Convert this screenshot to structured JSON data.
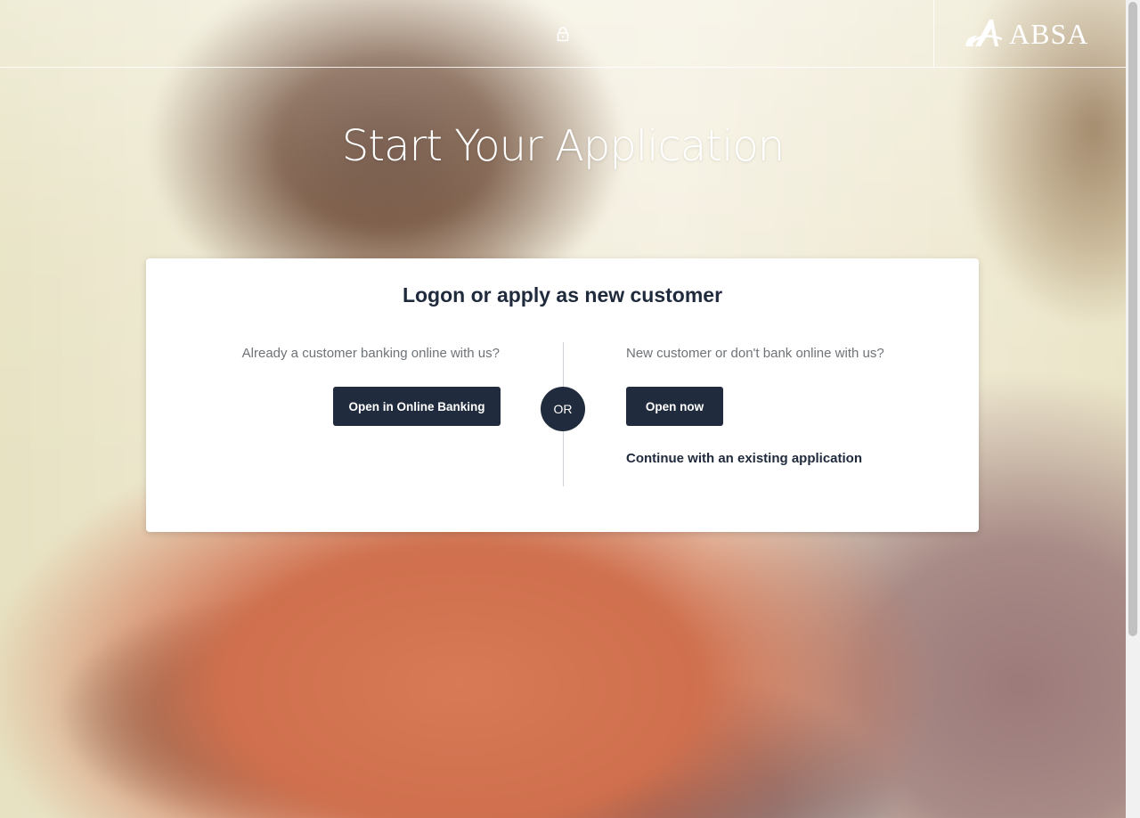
{
  "header": {
    "lock_icon": "lock-icon",
    "logo_text": "ABSA"
  },
  "page": {
    "title": "Start Your Application"
  },
  "card": {
    "title": "Logon or apply as new customer",
    "left": {
      "prompt": "Already a customer banking online with us?",
      "button_label": "Open in Online Banking"
    },
    "separator_label": "OR",
    "right": {
      "prompt": "New customer or don't bank online with us?",
      "button_label": "Open now",
      "link_label": "Continue with an existing application"
    }
  },
  "colors": {
    "primary_dark": "#202c3d",
    "text_muted": "#6e7378",
    "card_bg": "#ffffff"
  }
}
